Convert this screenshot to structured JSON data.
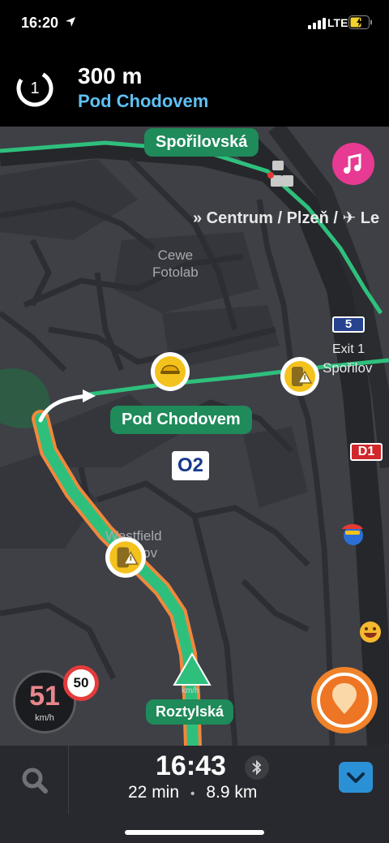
{
  "status_bar": {
    "time": "16:20",
    "network": "LTE"
  },
  "navigation": {
    "turn_exit_number": "1",
    "distance": "300 m",
    "next_street": "Pod Chodovem"
  },
  "map": {
    "street_label_top": "Spořilovská",
    "street_label_turn": "Pod Chodovem",
    "street_label_current": "Roztylská",
    "exit_sign_direction": "» Centrum / Plzeň / ✈ Le",
    "exit_sign_number": "Exit 1",
    "exit_sign_name": "Spořilov",
    "highway_shield_5": "5",
    "highway_shield_d1": "D1",
    "poi_cewe": "Cewe\nFotolab",
    "poi_westfield": "Westfield\nChodov",
    "o2_logo": "O2",
    "icons": [
      "music-icon",
      "construction-worker-icon",
      "phone-warning-icon",
      "speed-camera-icon",
      "emoji-wazer-icon",
      "car-arrow-icon"
    ],
    "colors": {
      "route": "#2fbf7d",
      "traffic": "#f2873c",
      "label_bg": "#1f8a5a",
      "street_link": "#5ec1f5"
    }
  },
  "speed": {
    "current": "51",
    "unit": "km/h",
    "limit": "50",
    "car_unit": "km/h"
  },
  "eta": {
    "arrival_time": "16:43",
    "duration": "22 min",
    "separator": "•",
    "distance": "8.9 km"
  }
}
